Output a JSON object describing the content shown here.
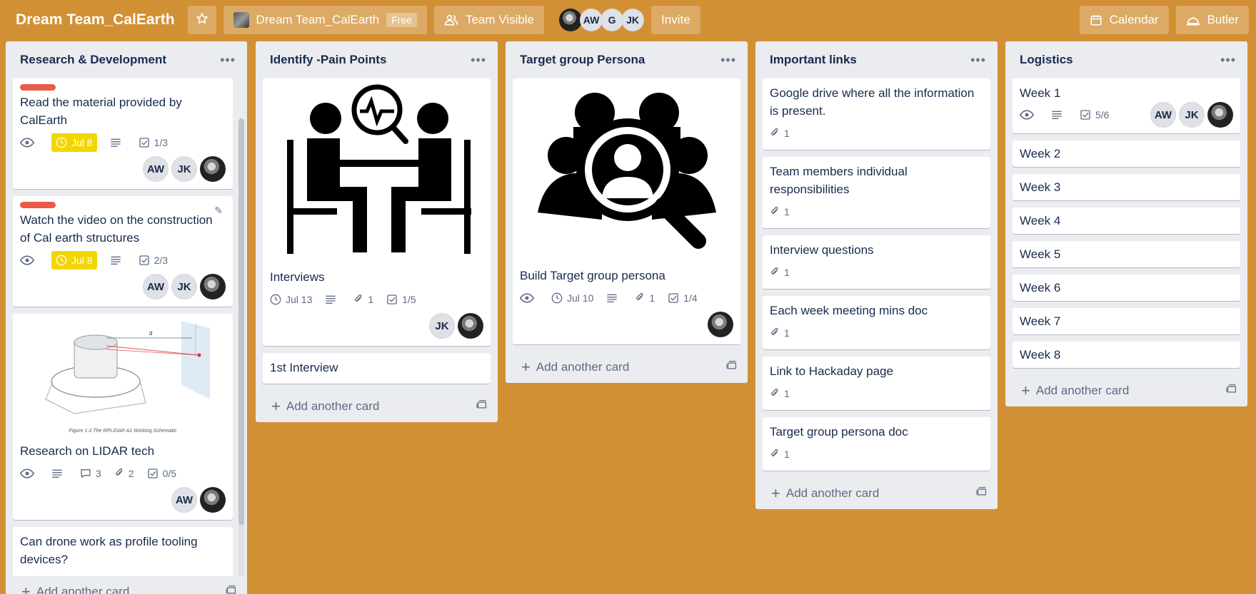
{
  "header": {
    "board_title": "Dream Team_CalEarth",
    "workspace_name": "Dream Team_CalEarth",
    "workspace_badge": "Free",
    "visibility_label": "Team Visible",
    "members": [
      "AW",
      "G",
      "JK"
    ],
    "invite_label": "Invite",
    "calendar_label": "Calendar",
    "butler_label": "Butler",
    "icons": [
      "star-icon",
      "team-visible-icon",
      "calendar-icon",
      "butler-icon"
    ]
  },
  "colors": {
    "board_background": "#D29034",
    "list_background": "#ebecf0",
    "label_red": "#eb5a46",
    "due_yellow": "#f2d600"
  },
  "lists": [
    {
      "title": "Research & Development",
      "add_label": "Add another card",
      "cards": [
        {
          "title": "Read the material provided by CalEarth",
          "due": "Jul 8",
          "checklist": "1/3",
          "members": [
            "AW",
            "JK"
          ]
        },
        {
          "title": "Watch the video on the construction of Cal earth structures",
          "due": "Jul 8",
          "checklist": "2/3",
          "members": [
            "AW",
            "JK"
          ]
        },
        {
          "title": "Research on LIDAR tech",
          "image_caption": "Figure 1-2 The RPLIDAR A1 Working Schematic",
          "image_label": "d",
          "comments": "3",
          "attachments": "2",
          "checklist": "0/5",
          "members": [
            "AW"
          ]
        },
        {
          "title": "Can drone work as profile tooling devices?"
        }
      ]
    },
    {
      "title": "Identify -Pain Points",
      "add_label": "Add another card",
      "cards": [
        {
          "title": "Interviews",
          "due": "Jul 13",
          "attachments": "1",
          "checklist": "1/5",
          "members": [
            "JK"
          ]
        },
        {
          "title": "1st Interview"
        }
      ]
    },
    {
      "title": "Target group Persona",
      "add_label": "Add another card",
      "cards": [
        {
          "title": "Build Target group persona",
          "due": "Jul 10",
          "attachments": "1",
          "checklist": "1/4"
        }
      ]
    },
    {
      "title": "Important links",
      "add_label": "Add another card",
      "cards": [
        {
          "title": "Google drive where all the information is present.",
          "attachments": "1"
        },
        {
          "title": "Team members individual responsibilities",
          "attachments": "1"
        },
        {
          "title": "Interview questions",
          "attachments": "1"
        },
        {
          "title": "Each week meeting mins doc",
          "attachments": "1"
        },
        {
          "title": "Link to Hackaday page",
          "attachments": "1"
        },
        {
          "title": "Target group persona doc",
          "attachments": "1"
        }
      ]
    },
    {
      "title": "Logistics",
      "add_label": "Add another card",
      "cards": [
        {
          "title": "Week 1",
          "checklist": "5/6",
          "members": [
            "AW",
            "JK"
          ]
        },
        {
          "title": "Week 2"
        },
        {
          "title": "Week 3"
        },
        {
          "title": "Week 4"
        },
        {
          "title": "Week 5"
        },
        {
          "title": "Week 6"
        },
        {
          "title": "Week 7"
        },
        {
          "title": "Week 8"
        }
      ]
    }
  ]
}
